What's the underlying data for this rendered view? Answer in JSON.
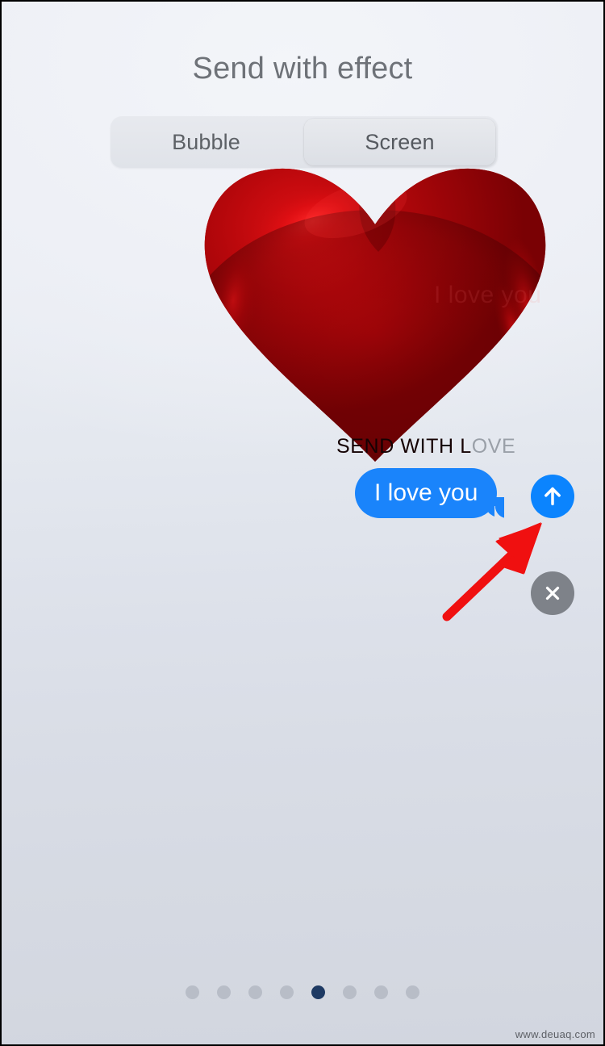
{
  "header": {
    "title": "Send with effect"
  },
  "segmented_control": {
    "options": [
      {
        "label": "Bubble",
        "selected": false
      },
      {
        "label": "Screen",
        "selected": true
      }
    ]
  },
  "effect_preview": {
    "name": "heart-balloon",
    "label": "SEND WITH LOVE",
    "label_part_on_heart": "SEND WITH L",
    "label_part_off_heart": "OVE",
    "ghost_text": "I love you",
    "heart_color": "#b3080c",
    "heart_highlight_color": "#ff1a1a",
    "heart_shadow_color": "#5e0002"
  },
  "message": {
    "text": "I love you",
    "bubble_color": "#1a84fb",
    "text_color": "#ffffff"
  },
  "actions": {
    "send": {
      "icon": "arrow-up-icon",
      "color": "#0b84fe"
    },
    "close": {
      "icon": "close-x-icon",
      "color": "#7e8289"
    }
  },
  "annotation": {
    "type": "arrow",
    "color": "#f01010",
    "points_to": "send-button"
  },
  "page_indicator": {
    "total": 8,
    "active_index": 4,
    "active_color": "#1e3a63",
    "inactive_color": "#b8bdc7"
  },
  "watermark": {
    "text": "www.deuaq.com"
  }
}
